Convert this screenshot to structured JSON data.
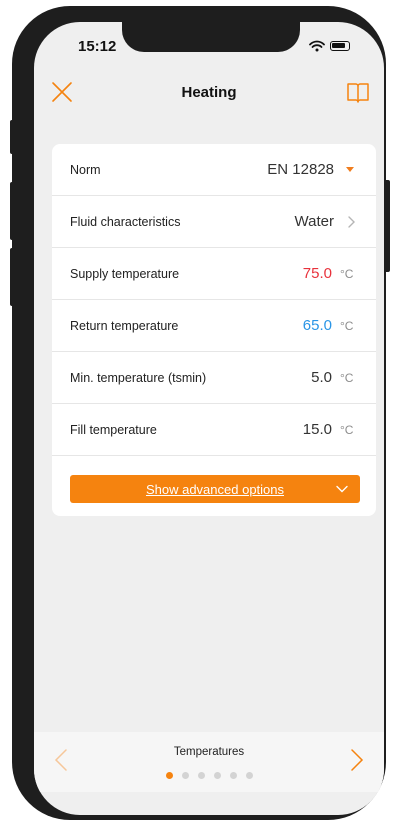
{
  "status": {
    "time": "15:12"
  },
  "nav": {
    "title": "Heating",
    "close_icon": "close-icon",
    "book_icon": "book-icon"
  },
  "rows": [
    {
      "label": "Norm",
      "value": "EN 12828",
      "control": "dropdown"
    },
    {
      "label": "Fluid characteristics",
      "value": "Water",
      "control": "chevron"
    },
    {
      "label": "Supply temperature",
      "value": "75.0",
      "unit": "°C",
      "color": "#e8323c"
    },
    {
      "label": "Return temperature",
      "value": "65.0",
      "unit": "°C",
      "color": "#2a95e6"
    },
    {
      "label": "Min. temperature (tsmin)",
      "value": "5.0",
      "unit": "°C"
    },
    {
      "label": "Fill temperature",
      "value": "15.0",
      "unit": "°C"
    }
  ],
  "advanced": {
    "label": "Show advanced options"
  },
  "pager": {
    "label": "Temperatures",
    "total_pages": 6,
    "current_page": 1
  },
  "colors": {
    "accent": "#f5830f",
    "background": "#efefef"
  }
}
